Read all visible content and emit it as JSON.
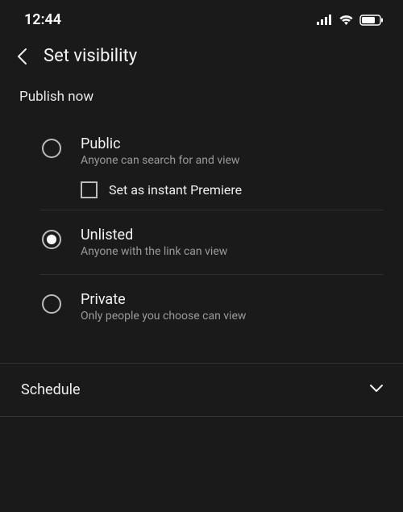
{
  "status": {
    "time": "12:44"
  },
  "header": {
    "title": "Set visibility"
  },
  "section": {
    "publish_now": "Publish now"
  },
  "options": {
    "public": {
      "title": "Public",
      "desc": "Anyone can search for and view",
      "premiere_label": "Set as instant Premiere"
    },
    "unlisted": {
      "title": "Unlisted",
      "desc": "Anyone with the link can view"
    },
    "private": {
      "title": "Private",
      "desc": "Only people you choose can view"
    }
  },
  "schedule": {
    "label": "Schedule"
  }
}
